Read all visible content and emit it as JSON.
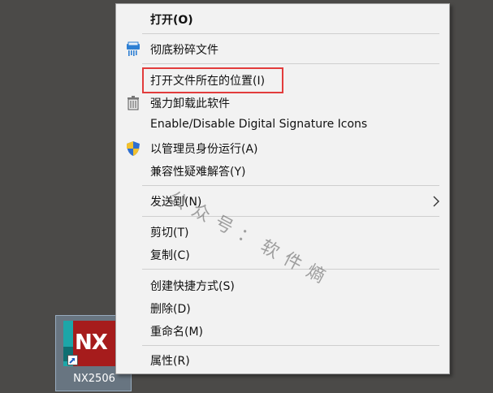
{
  "desktop": {
    "shortcut_label": "NX2506",
    "app_icon_text": "NX"
  },
  "menu": {
    "items": [
      {
        "label": "打开(O)"
      },
      {
        "label": "彻底粉碎文件"
      },
      {
        "label": "打开文件所在的位置(I)"
      },
      {
        "label": "强力卸载此软件"
      },
      {
        "label": "Enable/Disable Digital Signature Icons"
      },
      {
        "label": "以管理员身份运行(A)"
      },
      {
        "label": "兼容性疑难解答(Y)"
      },
      {
        "label": "发送到(N)"
      },
      {
        "label": "剪切(T)"
      },
      {
        "label": "复制(C)"
      },
      {
        "label": "创建快捷方式(S)"
      },
      {
        "label": "删除(D)"
      },
      {
        "label": "重命名(M)"
      },
      {
        "label": "属性(R)"
      }
    ],
    "icons": [
      "shredder-icon",
      "uninstall-icon",
      "uac-shield-icon",
      "chevron-right-icon"
    ]
  },
  "watermark": "公众号：软件熵",
  "colors": {
    "desktop_bg": "#4b4a48",
    "menu_bg": "#f2f2f2",
    "highlight_border": "#e23c3c",
    "app_icon_red": "#a61c1c",
    "app_icon_teal": "#1ca6a8"
  }
}
